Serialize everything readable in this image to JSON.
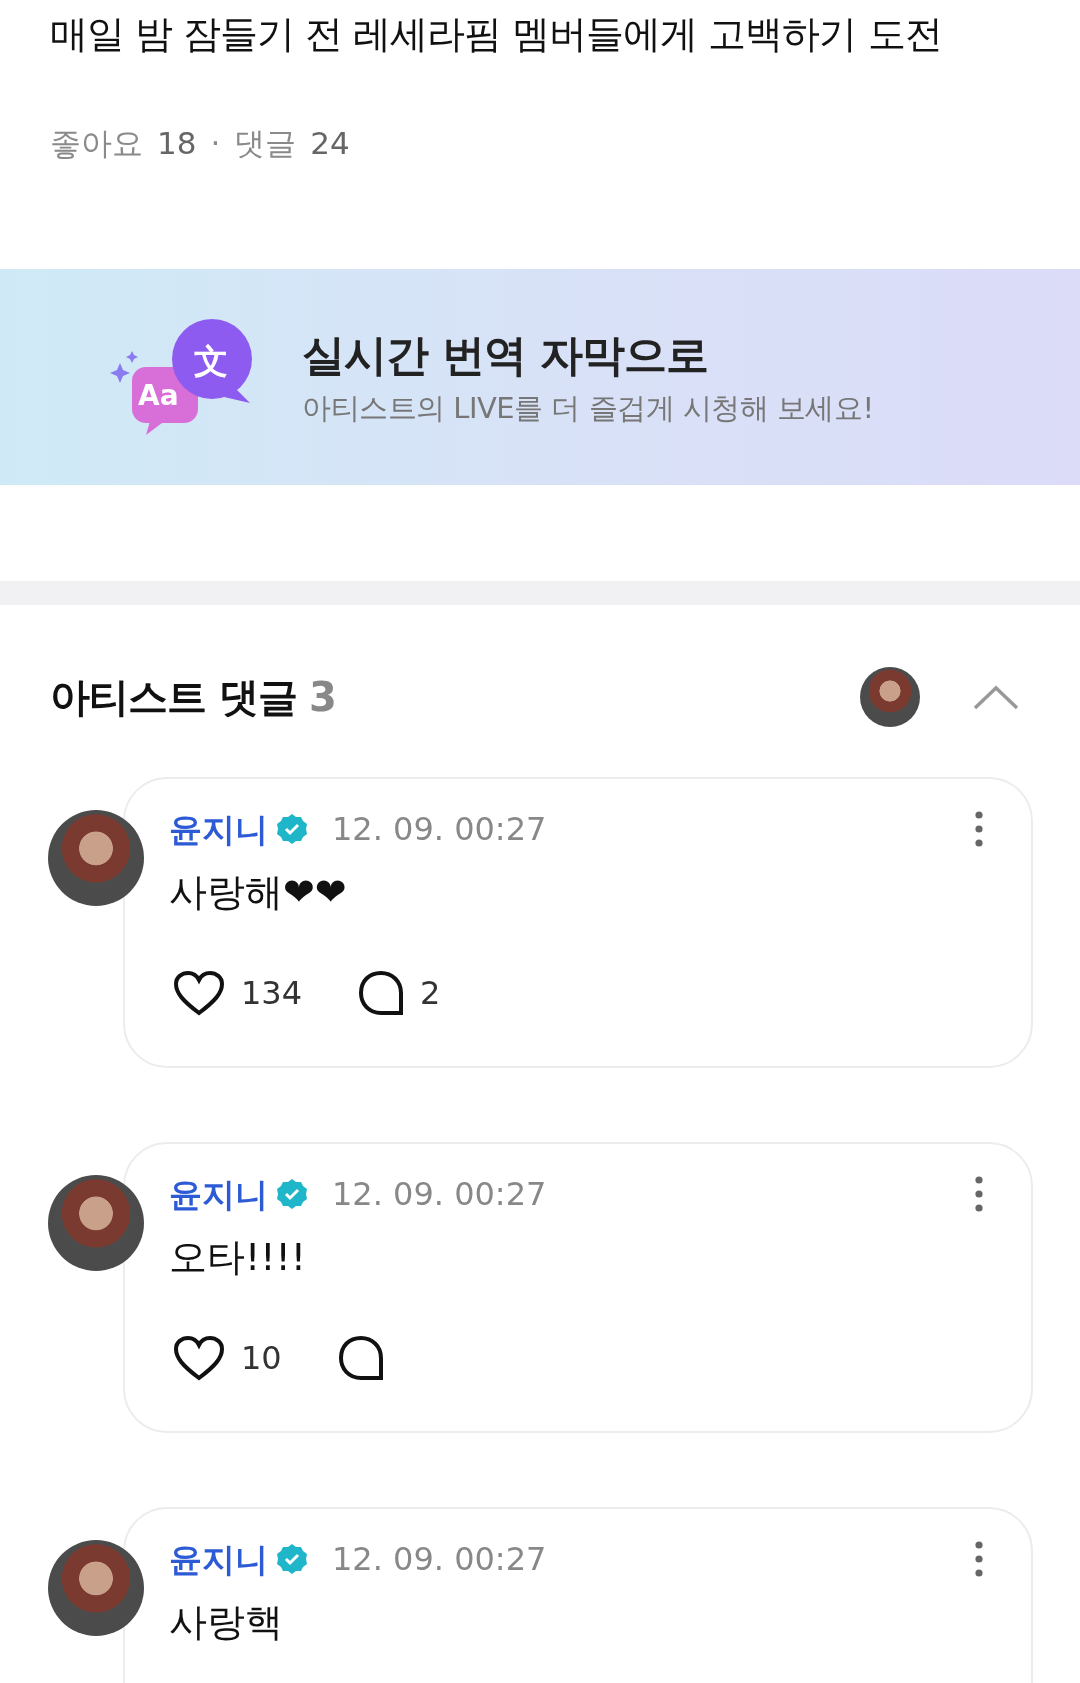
{
  "post": {
    "title": "매일 밤 잠들기 전 레세라핌 멤버들에게 고백하기 도전",
    "likes_label": "좋아요",
    "likes": "18",
    "separator": "·",
    "comments_label": "댓글",
    "comments": "24"
  },
  "banner": {
    "icon_glyph": "文",
    "icon_label": "Aa",
    "title": "실시간 번역 자막으로",
    "subtitle": "아티스트의 LIVE를 더 즐겁게 시청해 보세요!"
  },
  "artist_comments": {
    "title": "아티스트 댓글",
    "count": "3",
    "expanded": true,
    "items": [
      {
        "author": "윤지니",
        "verified": true,
        "time": "12. 09. 00:27",
        "text": "사랑해❤❤",
        "likes": "134",
        "replies": "2"
      },
      {
        "author": "윤지니",
        "verified": true,
        "time": "12. 09. 00:27",
        "text": "오타!!!!",
        "likes": "10"
      },
      {
        "author": "윤지니",
        "verified": true,
        "time": "12. 09. 00:27",
        "text": "사랑핵"
      }
    ]
  }
}
